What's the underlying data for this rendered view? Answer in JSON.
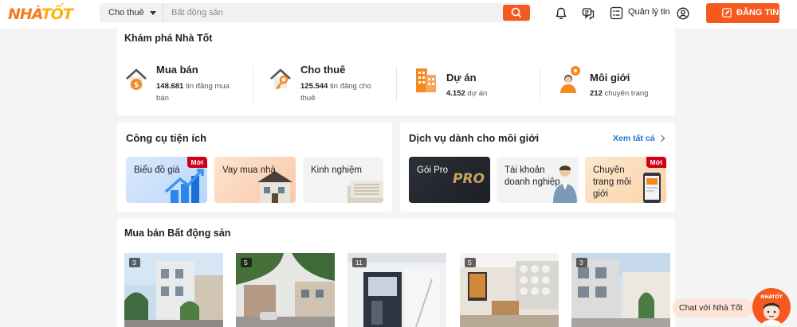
{
  "header": {
    "logo_main": "NHÀ",
    "logo_accent": "TỐT",
    "search_category": "Cho thuê",
    "search_placeholder": "Bất động sản",
    "manage_label": "Quản lý tin",
    "post_button": "ĐĂNG TIN"
  },
  "explore": {
    "title": "Khám phá Nhà Tốt",
    "items": [
      {
        "name": "Mua bán",
        "count": "148.681",
        "suffix": "tin đăng mua bán",
        "icon": "house-money-icon"
      },
      {
        "name": "Cho thuê",
        "count": "125.544",
        "suffix": "tin đăng cho thuê",
        "icon": "house-key-icon"
      },
      {
        "name": "Dự án",
        "count": "4.152",
        "suffix": "dự án",
        "icon": "building-icon"
      },
      {
        "name": "Môi giới",
        "count": "212",
        "suffix": "chuyên trang",
        "icon": "agent-icon"
      }
    ]
  },
  "tools": {
    "title": "Công cụ tiện ích",
    "items": [
      {
        "label": "Biểu đồ giá",
        "badge": "Mới"
      },
      {
        "label": "Vay mua nhà"
      },
      {
        "label": "Kinh nghiệm"
      }
    ]
  },
  "broker": {
    "title": "Dịch vụ dành cho môi giới",
    "see_all": "Xem tất cả",
    "items": [
      {
        "label": "Gói Pro",
        "art": "PRO"
      },
      {
        "label": "Tài khoản doanh nghiệp"
      },
      {
        "label": "Chuyên trang môi giới",
        "badge": "Mới"
      }
    ]
  },
  "listings": {
    "title": "Mua bán Bất động sản",
    "items": [
      {
        "photos": "3"
      },
      {
        "photos": "5"
      },
      {
        "photos": "11"
      },
      {
        "photos": "5"
      },
      {
        "photos": "3"
      }
    ]
  },
  "chat": {
    "label": "Chat với Nhà Tốt",
    "bot_text": "NHÀTỐT"
  },
  "colors": {
    "brand": "#f5591f",
    "badge": "#d0021b",
    "link": "#2470d6"
  }
}
